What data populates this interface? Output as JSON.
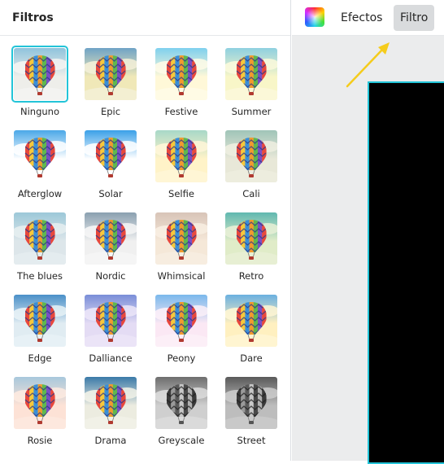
{
  "panel": {
    "title": "Filtros"
  },
  "toolbar": {
    "color_icon": "color-palette-icon",
    "efectos_label": "Efectos",
    "filtro_label": "Filtro",
    "active_tab": "Filtro",
    "accent": "#23c4d8",
    "arrow_color": "#f5cc1c"
  },
  "filters": [
    {
      "label": "Ninguno",
      "selected": true
    },
    {
      "label": "Epic"
    },
    {
      "label": "Festive"
    },
    {
      "label": "Summer"
    },
    {
      "label": "Afterglow"
    },
    {
      "label": "Solar"
    },
    {
      "label": "Selfie"
    },
    {
      "label": "Cali"
    },
    {
      "label": "The blues"
    },
    {
      "label": "Nordic"
    },
    {
      "label": "Whimsical"
    },
    {
      "label": "Retro"
    },
    {
      "label": "Edge"
    },
    {
      "label": "Dalliance"
    },
    {
      "label": "Peony"
    },
    {
      "label": "Dare"
    },
    {
      "label": "Rosie"
    },
    {
      "label": "Drama"
    },
    {
      "label": "Greyscale"
    },
    {
      "label": "Street"
    }
  ]
}
